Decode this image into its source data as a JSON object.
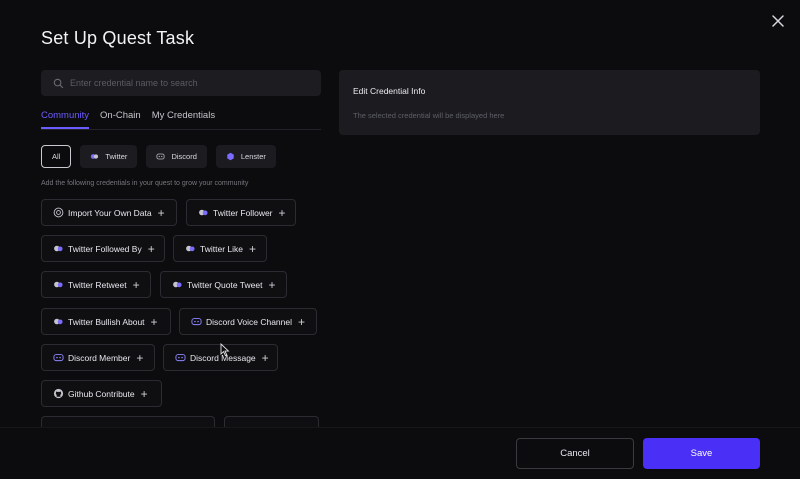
{
  "dialog": {
    "title": "Set Up Quest Task"
  },
  "search": {
    "placeholder": "Enter credential name to search",
    "value": ""
  },
  "tabs": [
    {
      "label": "Community",
      "active": true
    },
    {
      "label": "On-Chain",
      "active": false
    },
    {
      "label": "My Credentials",
      "active": false
    }
  ],
  "filters": [
    {
      "label": "All",
      "icon": "",
      "selected": true
    },
    {
      "label": "Twitter",
      "icon": "twitter-icon",
      "selected": false
    },
    {
      "label": "Discord",
      "icon": "discord-icon",
      "selected": false
    },
    {
      "label": "Lenster",
      "icon": "lenster-icon",
      "selected": false
    }
  ],
  "hint": "Add the following credentials in your quest to grow your community",
  "credentials": [
    {
      "label": "Import Your Own Data",
      "icon": "data-icon"
    },
    {
      "label": "Twitter Follower",
      "icon": "twitter-icon"
    },
    {
      "label": "Twitter Followed By",
      "icon": "twitter-icon"
    },
    {
      "label": "Twitter Like",
      "icon": "twitter-icon"
    },
    {
      "label": "Twitter Retweet",
      "icon": "twitter-icon"
    },
    {
      "label": "Twitter Quote Tweet",
      "icon": "twitter-icon"
    },
    {
      "label": "Twitter Bullish About",
      "icon": "twitter-icon"
    },
    {
      "label": "Discord Voice Channel",
      "icon": "discord-icon"
    },
    {
      "label": "Discord Member",
      "icon": "discord-icon"
    },
    {
      "label": "Discord Message",
      "icon": "discord-icon"
    },
    {
      "label": "Github Contribute",
      "icon": "github-icon"
    }
  ],
  "edit_panel": {
    "title": "Edit Credential Info",
    "description": "The selected credential will be displayed here"
  },
  "footer": {
    "cancel_label": "Cancel",
    "save_label": "Save"
  },
  "colors": {
    "accent": "#6b5cff",
    "primary_button": "#4a2ff7",
    "background": "#0c0c0e"
  }
}
